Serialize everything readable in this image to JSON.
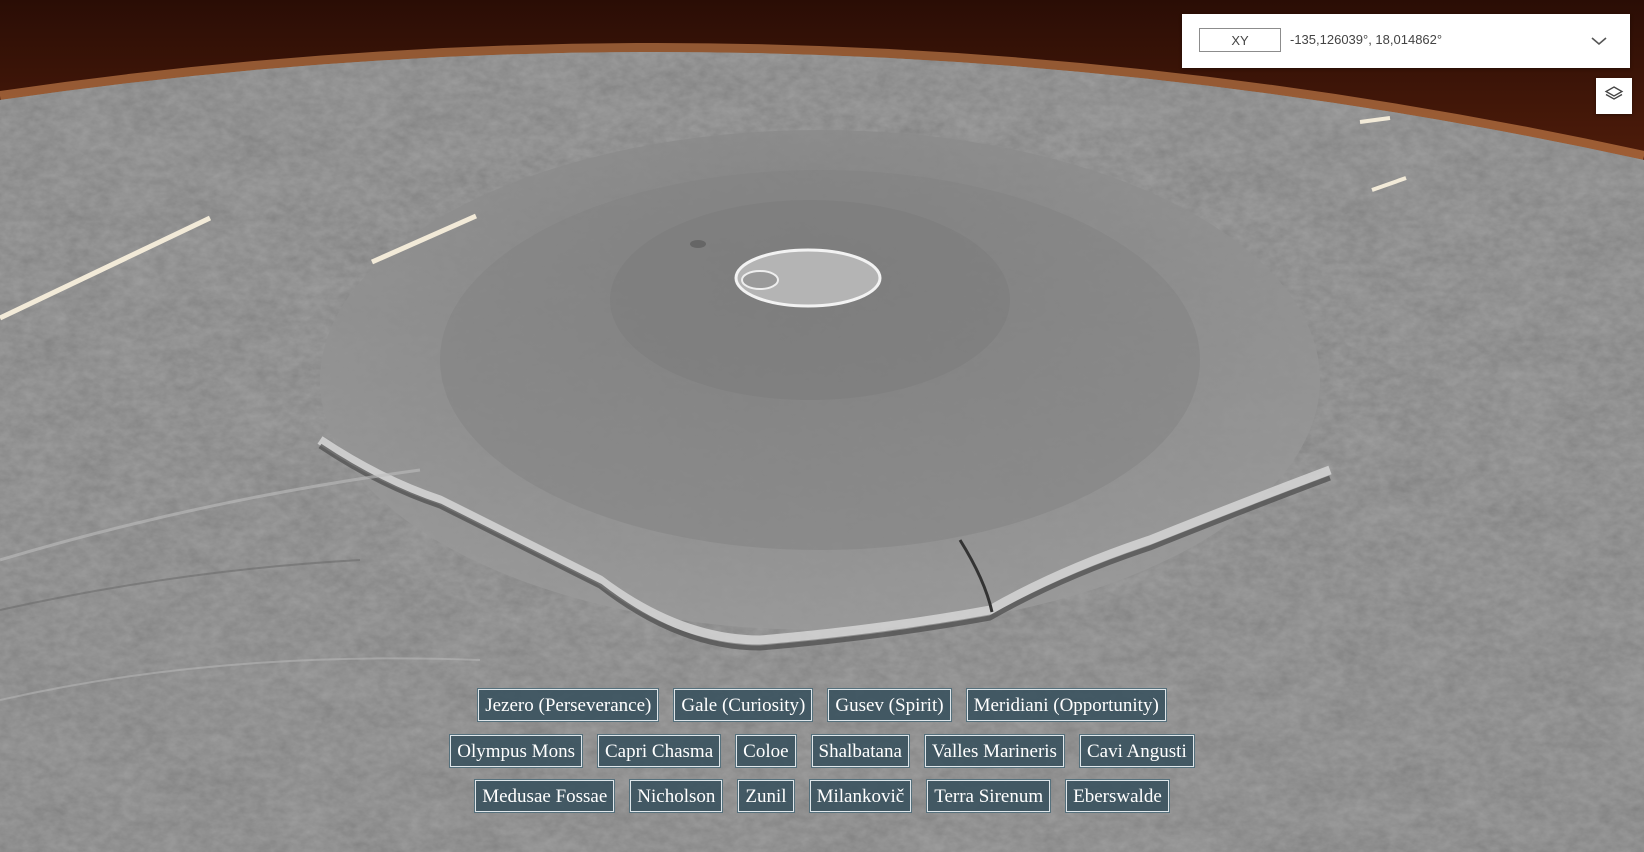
{
  "coordinate_widget": {
    "format_label": "XY",
    "value": "-135,126039°, 18,014862°",
    "chevron_icon": "chevron-down-icon"
  },
  "layers_button": {
    "icon": "layers-icon"
  },
  "locations": {
    "row1": [
      "Jezero (Perseverance)",
      "Gale (Curiosity)",
      "Gusev (Spirit)",
      "Meridiani (Opportunity)"
    ],
    "row2": [
      "Olympus Mons",
      "Capri Chasma",
      "Coloe",
      "Shalbatana",
      "Valles Marineris",
      "Cavi Angusti"
    ],
    "row3": [
      "Medusae Fossae",
      "Nicholson",
      "Zunil",
      "Milankovič",
      "Terra Sirenum",
      "Eberswalde"
    ]
  },
  "colors": {
    "sky_glow": "#c8531e",
    "terrain": "#8e8e8e",
    "button_bg": "#3c5460"
  }
}
